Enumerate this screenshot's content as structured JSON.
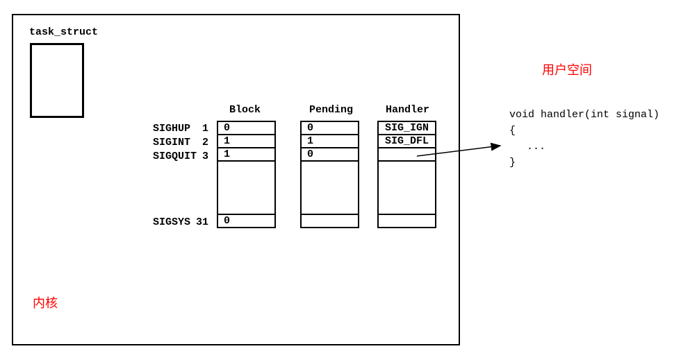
{
  "labels": {
    "task_struct": "task_struct",
    "kernel": "内核",
    "userspace": "用户空间"
  },
  "headers": {
    "block": "Block",
    "pending": "Pending",
    "handler": "Handler"
  },
  "signals": {
    "row1": {
      "name": "SIGHUP",
      "num": "1",
      "block": "0",
      "pending": "0",
      "handler": "SIG_IGN"
    },
    "row2": {
      "name": "SIGINT",
      "num": "2",
      "block": "1",
      "pending": "1",
      "handler": "SIG_DFL"
    },
    "row3": {
      "name": "SIGQUIT",
      "num": "3",
      "block": "1",
      "pending": "0",
      "handler": ""
    },
    "last": {
      "name": "SIGSYS",
      "num": "31",
      "block": "0",
      "pending": "",
      "handler": ""
    }
  },
  "code": {
    "line1": "void handler(int signal)",
    "line2": "{",
    "line3": "...",
    "line4": "}"
  }
}
